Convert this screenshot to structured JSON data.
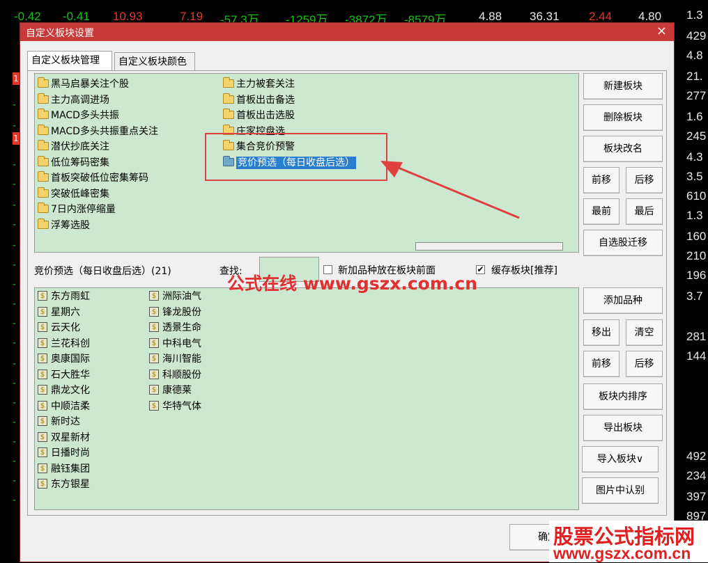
{
  "background": {
    "top_row": [
      "-0.42",
      "-0.41",
      "10.93",
      "7.19",
      "-57.3万",
      "-1259万",
      "-3872万",
      "-8579万",
      "4.88",
      "36.31",
      "2.44",
      "4.80"
    ],
    "right_col": [
      "1.3",
      "429",
      "4.8",
      "21.",
      "277",
      "1.6",
      "245",
      "4.3",
      "3.5",
      "610",
      "1.3",
      "160",
      "210",
      "196",
      "3.7",
      "281",
      "144",
      "492",
      "234",
      "397",
      "897"
    ],
    "red_markers": [
      "1",
      "1"
    ]
  },
  "dialog": {
    "title": "自定义板块设置",
    "close": "×",
    "tabs": [
      "自定义板块管理",
      "自定义板块颜色"
    ],
    "blocks_col1": [
      "黑马启暴关注个股",
      "主力高调进场",
      "MACD多头共振",
      "MACD多头共振重点关注",
      "潜伏抄底关注",
      "低位筹码密集",
      "首板突破低位密集筹码",
      "突破低峰密集",
      "7日内涨停缩量",
      "浮筹选股"
    ],
    "blocks_col2": [
      "主力被套关注",
      "首板出击备选",
      "首板出击选股",
      "庄家控盘选",
      "集合竞价预警",
      "竞价预选（每日收盘后选）"
    ],
    "block_buttons": {
      "new": "新建板块",
      "delete": "删除板块",
      "rename": "板块改名",
      "move_up": "前移",
      "move_down": "后移",
      "first": "最前",
      "last": "最后",
      "migrate": "自选股迁移"
    },
    "current_block_label": "竞价预选（每日收盘后选）(21)",
    "search_label": "查找:",
    "search_value": "",
    "opt_new_front": {
      "label": "新加品种放在板块前面",
      "checked": false
    },
    "opt_cache": {
      "label": "缓存板块[推荐]",
      "checked": true
    },
    "stocks_col1": [
      "东方雨虹",
      "星期六",
      "云天化",
      "兰花科创",
      "奥康国际",
      "石大胜华",
      "鼎龙文化",
      "中顺洁柔",
      "新时达",
      "双星新材",
      "日播时尚",
      "融钰集团",
      "东方银星"
    ],
    "stocks_col2": [
      "洲际油气",
      "锋龙股份",
      "透景生命",
      "中科电气",
      "海川智能",
      "科顺股份",
      "康德莱",
      "华特气体"
    ],
    "stock_buttons": {
      "add": "添加品种",
      "remove": "移出",
      "clear": "清空",
      "move_up": "前移",
      "move_down": "后移",
      "sort": "板块内排序",
      "export": "导出板块",
      "import": "导入板块∨",
      "recognize": "图片中认别"
    },
    "ok_button": "确定"
  },
  "watermarks": {
    "center": "公式在线 www.gszx.com.cn",
    "brand_line1": "股票公式指标网",
    "brand_line2": "www.gszx.com.cn"
  },
  "colors": {
    "title_bar": "#c83a3a",
    "list_bg": "#cde8d0",
    "selection": "#2a7ed0",
    "annotation": "#e04040"
  }
}
